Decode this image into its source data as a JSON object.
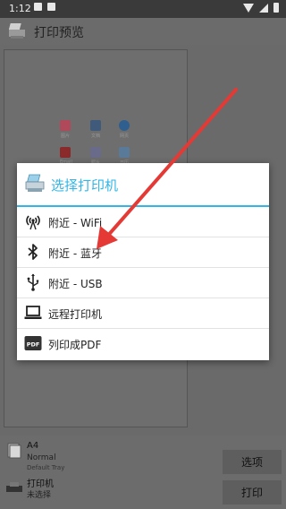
{
  "status_bar": {
    "time": "1:12"
  },
  "action_bar": {
    "title": "打印预览"
  },
  "preview": {
    "thumbnails": [
      "图片",
      "文档",
      "网页",
      "Email",
      "照片",
      "日历"
    ]
  },
  "bottom": {
    "paper_size": "A4",
    "paper_mode": "Normal",
    "paper_tray": "Default Tray",
    "printer_name": "打印机",
    "printer_status": "未选择",
    "options_button": "选项",
    "print_button": "打印"
  },
  "dialog": {
    "title": "选择打印机",
    "options": [
      {
        "label": "附近 - WiFi",
        "icon": "wifi-antenna-icon"
      },
      {
        "label": "附近 - 蓝牙",
        "icon": "bluetooth-icon"
      },
      {
        "label": "附近 - USB",
        "icon": "usb-icon"
      },
      {
        "label": "远程打印机",
        "icon": "laptop-icon"
      },
      {
        "label": "列印成PDF",
        "icon": "pdf-icon"
      }
    ]
  },
  "colors": {
    "accent": "#33b5e5",
    "annotation_arrow": "#e53935"
  }
}
